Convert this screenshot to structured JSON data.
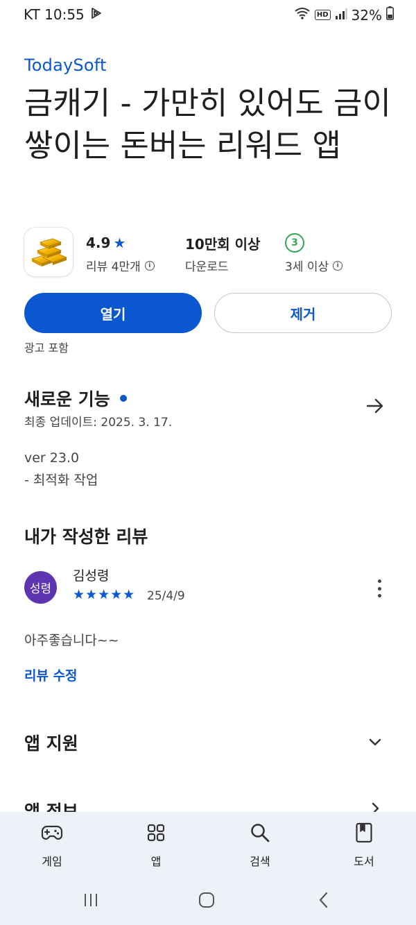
{
  "status_bar": {
    "carrier_time": "KT 10:55",
    "hd": "HD",
    "battery": "32%"
  },
  "app": {
    "developer": "TodaySoft",
    "title": "금캐기 - 가만히 있어도 금이 쌓이는 돈버는 리워드 앱",
    "rating": "4.9",
    "rating_star": "★",
    "reviews": "리뷰 4만개",
    "downloads": "10만회 이상",
    "downloads_label": "다운로드",
    "age_badge": "3",
    "age_label": "3세 이상",
    "open_label": "열기",
    "remove_label": "제거",
    "ad_note": "광고 포함"
  },
  "whats_new": {
    "title": "새로운 기능",
    "updated": "최종 업데이트: 2025. 3. 17.",
    "version": "ver 23.0",
    "note": "- 최적화 작업"
  },
  "my_review": {
    "title": "내가 작성한 리뷰",
    "avatar_text": "성령",
    "reviewer": "김성령",
    "stars": "★★★★★",
    "rating": 5,
    "date": "25/4/9",
    "text": "아주좋습니다~~",
    "edit_label": "리뷰 수정"
  },
  "app_support": {
    "title": "앱 지원"
  },
  "app_info": {
    "title": "앱 정보"
  },
  "bottom_nav": [
    {
      "label": "게임",
      "icon": "gamepad-icon"
    },
    {
      "label": "앱",
      "icon": "apps-grid-icon"
    },
    {
      "label": "검색",
      "icon": "search-icon"
    },
    {
      "label": "도서",
      "icon": "book-icon"
    }
  ],
  "colors": {
    "accent": "#0b57d0",
    "avatar": "#5e35b1",
    "age_badge": "#34a853",
    "nav_bg": "#eef1f7"
  }
}
